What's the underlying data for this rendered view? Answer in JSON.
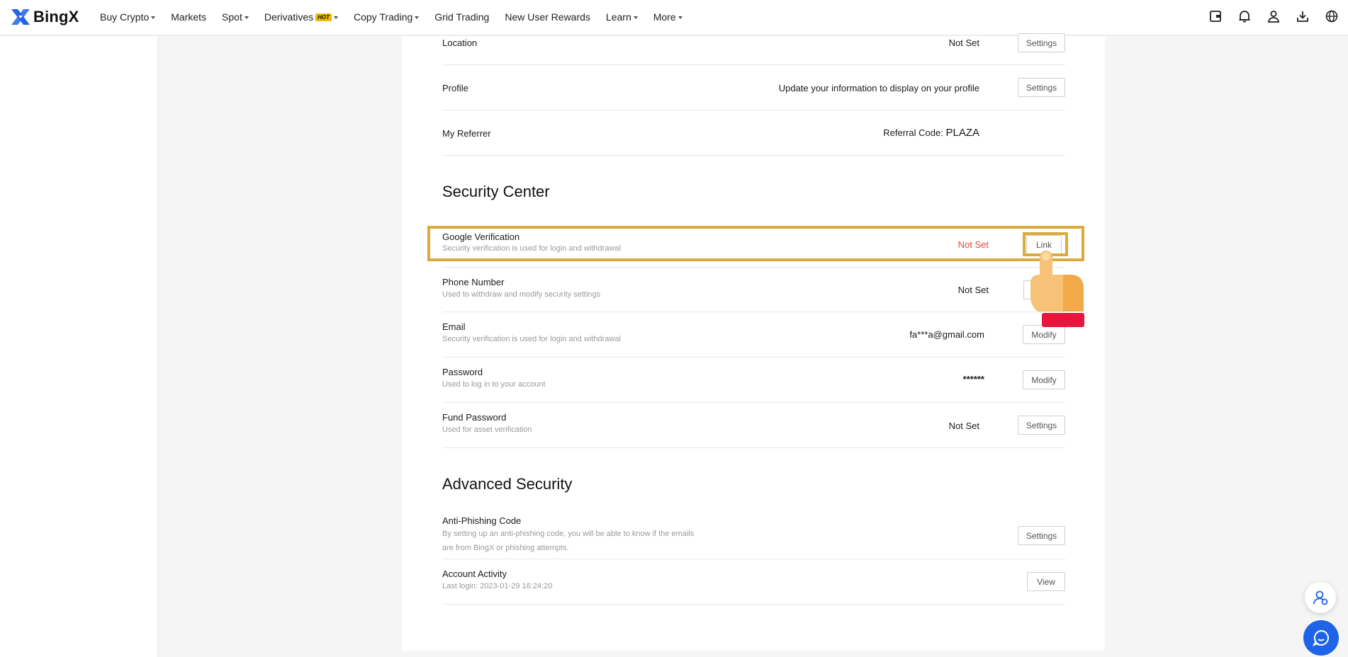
{
  "brand": {
    "name": "BingX"
  },
  "nav": {
    "items": [
      {
        "label": "Buy Crypto",
        "dropdown": true
      },
      {
        "label": "Markets",
        "dropdown": false
      },
      {
        "label": "Spot",
        "dropdown": true
      },
      {
        "label": "Derivatives",
        "dropdown": true,
        "badge": "HOT"
      },
      {
        "label": "Copy Trading",
        "dropdown": true
      },
      {
        "label": "Grid Trading",
        "dropdown": false
      },
      {
        "label": "New User Rewards",
        "dropdown": false
      },
      {
        "label": "Learn",
        "dropdown": true
      },
      {
        "label": "More",
        "dropdown": true
      }
    ],
    "icons": [
      "wallet-icon",
      "bell-icon",
      "user-icon",
      "download-icon",
      "globe-icon"
    ]
  },
  "profile_rows": {
    "location": {
      "title": "Location",
      "value": "Not Set",
      "button": "Settings"
    },
    "profile": {
      "title": "Profile",
      "value": "Update your information to display on your profile",
      "button": "Settings"
    },
    "referrer": {
      "title": "My Referrer",
      "value_label": "Referral Code:",
      "value": "PLAZA"
    }
  },
  "security_center": {
    "heading": "Security Center",
    "google": {
      "title": "Google Verification",
      "desc": "Security verification is used for login and withdrawal",
      "value": "Not Set",
      "button": "Link"
    },
    "phone": {
      "title": "Phone Number",
      "desc": "Used to withdraw and modify security settings",
      "value": "Not Set"
    },
    "email": {
      "title": "Email",
      "desc": "Security verification is used for login and withdrawal",
      "value": "fa***a@gmail.com",
      "button": "Modify"
    },
    "password": {
      "title": "Password",
      "desc": "Used to log in to your account",
      "value": "******",
      "button": "Modify"
    },
    "fund_password": {
      "title": "Fund Password",
      "desc": "Used for asset verification",
      "value": "Not Set",
      "button": "Settings"
    }
  },
  "advanced_security": {
    "heading": "Advanced Security",
    "anti_phishing": {
      "title": "Anti-Phishing Code",
      "desc_line1": "By setting up an anti-phishing code, you will be able to know if the emails",
      "desc_line2": "are from BingX or phishing attempts.",
      "button": "Settings"
    },
    "account_activity": {
      "title": "Account Activity",
      "desc": "Last login: 2023-01-29 16:24:20",
      "button": "View"
    }
  },
  "colors": {
    "brand_blue": "#1f63e6",
    "highlight": "#dcaa3a",
    "not_set_red": "#e9463c",
    "hot_badge": "#f0b90b"
  }
}
